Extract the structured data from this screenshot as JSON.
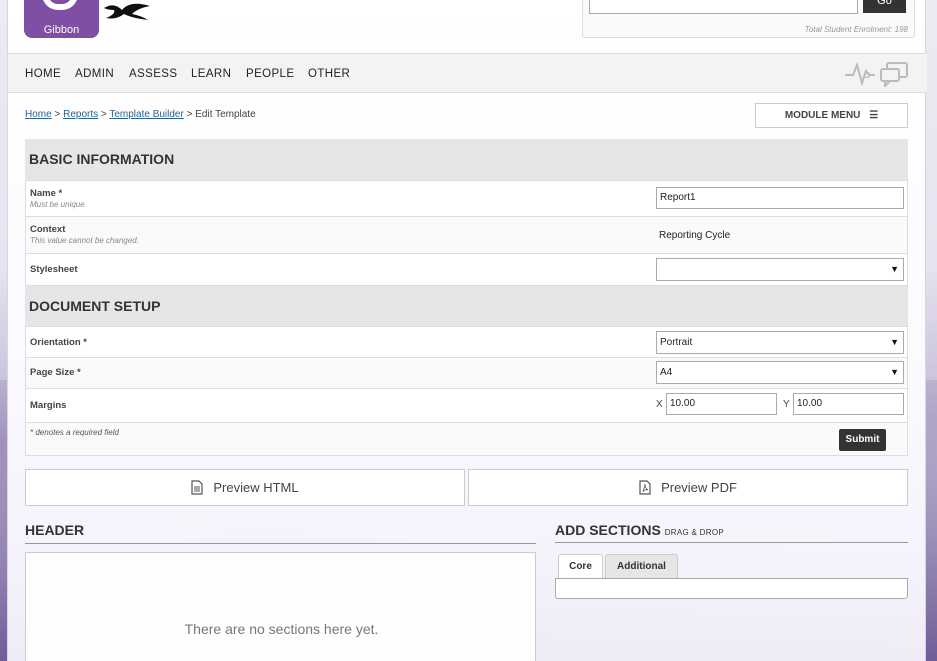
{
  "header": {
    "logo_text": "Gibbon",
    "search_button": "Go",
    "enrolment": "Total Student Enrolment: 198"
  },
  "nav": {
    "items": [
      "HOME",
      "ADMIN",
      "ASSESS",
      "LEARN",
      "PEOPLE",
      "OTHER"
    ]
  },
  "breadcrumb": {
    "home": "Home",
    "reports": "Reports",
    "template_builder": "Template Builder",
    "current": "Edit Template",
    "sep": ">"
  },
  "module_menu": "MODULE MENU",
  "basic_info": {
    "title": "BASIC INFORMATION",
    "name_label": "Name *",
    "name_desc": "Must be unique",
    "name_value": "Report1",
    "context_label": "Context",
    "context_desc": "This value cannot be changed.",
    "context_value": "Reporting Cycle",
    "stylesheet_label": "Stylesheet",
    "stylesheet_value": ""
  },
  "document_setup": {
    "title": "DOCUMENT SETUP",
    "orientation_label": "Orientation *",
    "orientation_value": "Portrait",
    "pagesize_label": "Page Size *",
    "pagesize_value": "A4",
    "margins_label": "Margins",
    "margin_x_label": "X",
    "margin_x_value": "10.00",
    "margin_y_label": "Y",
    "margin_y_value": "10.00",
    "required_note": "* denotes a required field",
    "submit": "Submit"
  },
  "preview": {
    "html": "Preview HTML",
    "pdf": "Preview PDF"
  },
  "header_section": {
    "title": "HEADER",
    "empty": "There are no sections here yet."
  },
  "add_sections": {
    "title": "ADD SECTIONS",
    "subtitle": "DRAG & DROP",
    "tabs": [
      "Core",
      "Additional"
    ]
  }
}
